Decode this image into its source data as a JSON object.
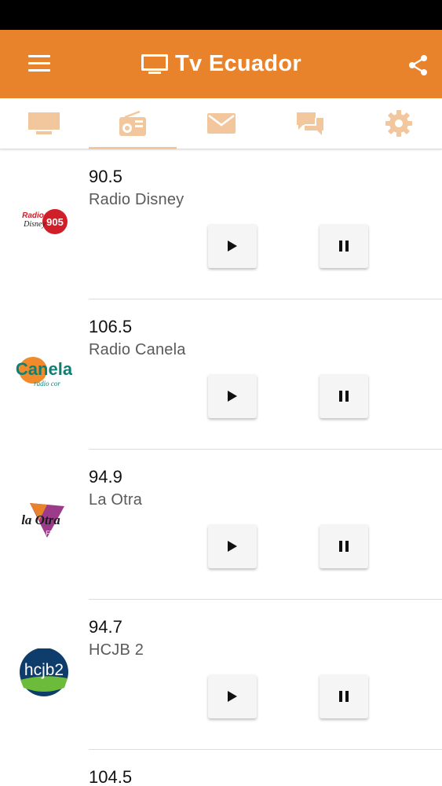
{
  "app": {
    "title": "Tv Ecuador"
  },
  "colors": {
    "appbar": "#e8832b",
    "tab_icon": "#f2c79e",
    "status_bar": "#000000"
  },
  "tabs": [
    {
      "icon": "tv-icon",
      "selected": false
    },
    {
      "icon": "radio-icon",
      "selected": true
    },
    {
      "icon": "mail-icon",
      "selected": false
    },
    {
      "icon": "chat-icon",
      "selected": false
    },
    {
      "icon": "gear-icon",
      "selected": false
    }
  ],
  "stations": [
    {
      "frequency": "90.5",
      "name": "Radio Disney",
      "logo": "radio-disney-logo"
    },
    {
      "frequency": "106.5",
      "name": "Radio Canela",
      "logo": "radio-canela-logo"
    },
    {
      "frequency": "94.9",
      "name": "La Otra",
      "logo": "la-otra-logo"
    },
    {
      "frequency": "94.7",
      "name": "HCJB 2",
      "logo": "hcjb2-logo"
    },
    {
      "frequency": "104.5",
      "name": "",
      "logo": ""
    }
  ],
  "logo_text": {
    "disney_top": "Radio",
    "disney_mid": "Disney",
    "disney_num": "905",
    "canela_main": "Canela",
    "canela_sub": "radio cor",
    "laotra": "la Otra",
    "laotra_fm": "FM",
    "hcjb": "hcjb2"
  }
}
